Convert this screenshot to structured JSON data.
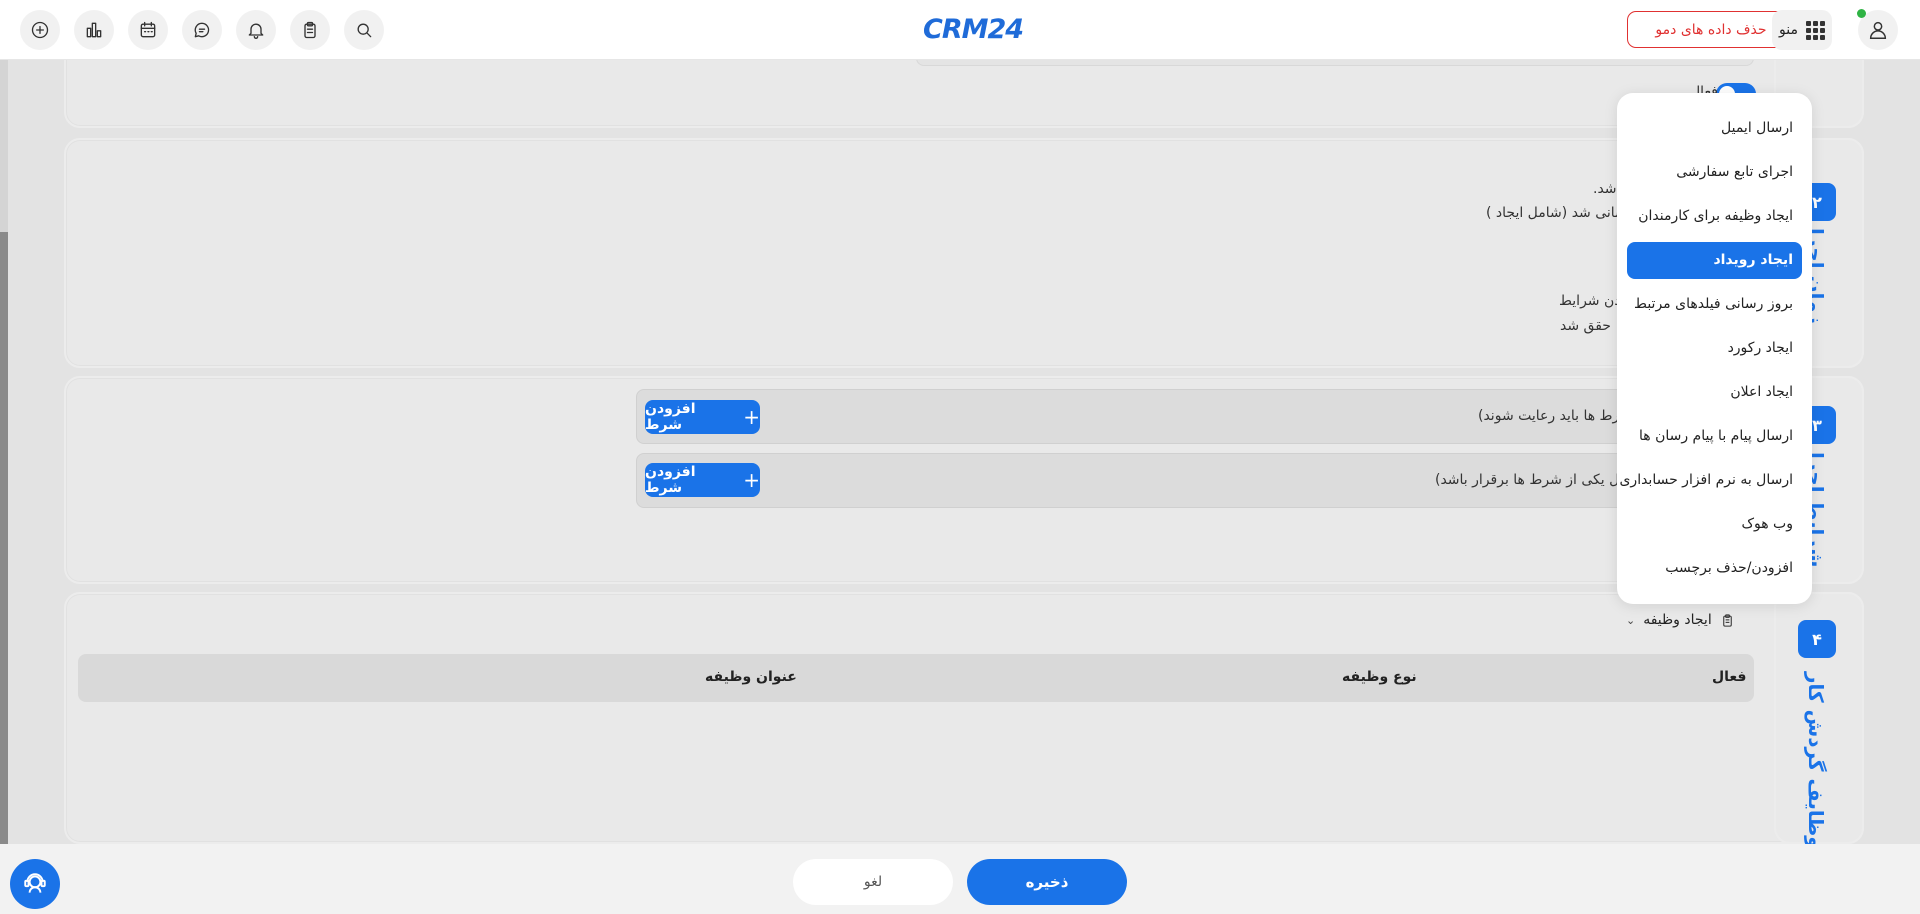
{
  "header": {
    "logo_text": "CRM24",
    "demo_delete_label": "حذف داده های دمو",
    "menu_label": "منو",
    "icons": [
      "add-icon",
      "chart-icon",
      "calendar-icon",
      "chat-icon",
      "bell-icon",
      "clipboard-icon",
      "search-icon",
      "apps-grid-icon",
      "user-icon"
    ]
  },
  "section1": {
    "active_label": "فعال"
  },
  "section2": {
    "step_number": "۲",
    "step_title": "زمان اجرا",
    "lines": [
      "شد.",
      "سانی شد (شامل ایجاد )",
      "دن شرایط",
      "حقق شد"
    ]
  },
  "section3": {
    "step_number": "۳",
    "step_title": "شرایط اجرا",
    "cond_all_text": "رط ها باید رعایت شوند)",
    "cond_any_text": "اقل یکی از شرط ها برقرار باشد)",
    "add_condition_label": "افزودن شرط"
  },
  "section4": {
    "step_number": "۴",
    "step_title": "وظایف گردش کار",
    "create_task_label": "ایجاد وظیفه",
    "table_headers": [
      "فعال",
      "نوع وظیفه",
      "عنوان وظیفه"
    ]
  },
  "dropdown": {
    "items": [
      "ارسال ایمیل",
      "اجرای تابع سفارشی",
      "ایجاد وظیفه برای کارمندان",
      "ایجاد رویداد",
      "بروز رسانی فیلدهای مرتبط",
      "ایجاد رکورد",
      "ایجاد اعلان",
      "ارسال پیام با پیام رسان ها",
      "ارسال به نرم افزار حسابداری",
      "وب هوک",
      "افزودن/حذف برچسب"
    ],
    "selected_index": 3
  },
  "footer": {
    "save_label": "ذخیره",
    "cancel_label": "لغو"
  },
  "colors": {
    "accent": "#1a73e8",
    "danger": "#e03131",
    "online": "#2fb344"
  }
}
